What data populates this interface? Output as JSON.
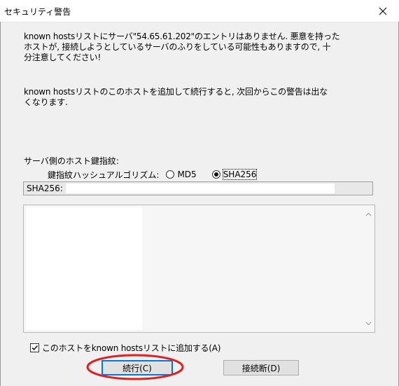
{
  "window": {
    "title": "セキュリティ警告",
    "close_glyph": "✕"
  },
  "message": {
    "line1": "known hostsリストにサーバ\"54.65.61.202\"のエントリはありません. 悪意を持った\nホストが, 接続しようとしているサーバのふりをしている可能性もありますので, 十\n分注意してください!",
    "line2": "known hostsリストのこのホストを追加して続行すると, 次回からこの警告は出な\nくなります."
  },
  "fingerprint": {
    "heading": "サーバ側のホスト鍵指紋:",
    "algo_label": "鍵指紋ハッシュアルゴリズム:",
    "options": [
      {
        "label": "MD5",
        "selected": false
      },
      {
        "label": "SHA256",
        "selected": true
      }
    ],
    "value": "SHA256:"
  },
  "add_checkbox": {
    "label": "このホストをknown hostsリストに追加する(A)",
    "checked": true
  },
  "buttons": {
    "continue": "続行(C)",
    "disconnect": "接続断(D)"
  },
  "colors": {
    "annotation": "#e02020",
    "focus": "#0078d7"
  },
  "icons": [
    "close-icon",
    "scroll-up-icon",
    "scroll-down-icon",
    "checkmark-icon"
  ]
}
